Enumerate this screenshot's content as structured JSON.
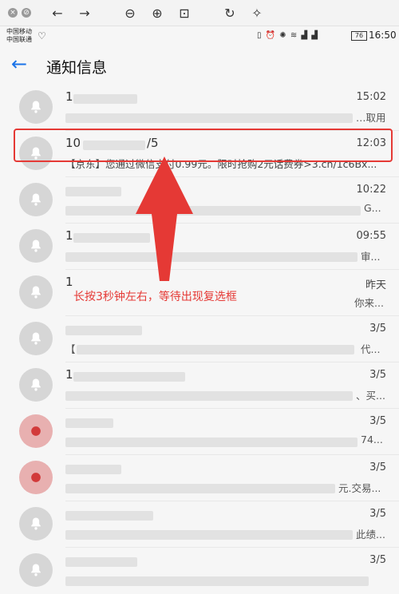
{
  "toolbar": {
    "icons": [
      "close-icon",
      "stop-icon",
      "back-arrow-icon",
      "forward-arrow-icon",
      "zoom-out-icon",
      "zoom-in-icon",
      "fit-icon",
      "rotate-icon",
      "magic-wand-icon"
    ]
  },
  "status_bar": {
    "carrier1": "中国移动",
    "carrier2": "中国联通",
    "battery": "76",
    "time": "16:50"
  },
  "header": {
    "title": "通知信息"
  },
  "messages": [
    {
      "sender": "1",
      "time": "15:02",
      "preview": "",
      "tail": "…取用"
    },
    {
      "sender": "10",
      "sender_tail": "/5",
      "time": "12:03",
      "preview": "【京东】您通过微信支付0.99元。限时抢购2元话费券>3.cn/1c6Bx..."
    },
    {
      "sender": "",
      "time": "10:22",
      "preview": "",
      "tail": "G..."
    },
    {
      "sender": "1",
      "time": "09:55",
      "preview": "",
      "tail": "审..."
    },
    {
      "sender": "1",
      "time": "昨天",
      "preview": "",
      "tail": "你来..."
    },
    {
      "sender": "",
      "time": "3/5",
      "preview": "【",
      "tail": "代..."
    },
    {
      "sender": "1",
      "time": "3/5",
      "preview": "",
      "tail": "、买..."
    },
    {
      "sender": "",
      "time": "3/5",
      "preview": "",
      "tail": "74..."
    },
    {
      "sender": "",
      "time": "3/5",
      "preview": "",
      "tail": "元.交易..."
    },
    {
      "sender": "",
      "time": "3/5",
      "preview": "",
      "tail": "此绩..."
    },
    {
      "sender": "",
      "time": "3/5",
      "preview": "",
      "tail": ""
    }
  ],
  "annotation": {
    "text": "长按3秒钟左右，等待出现复选框"
  },
  "colors": {
    "accent": "#1a73e8",
    "annotation": "#e53935"
  }
}
